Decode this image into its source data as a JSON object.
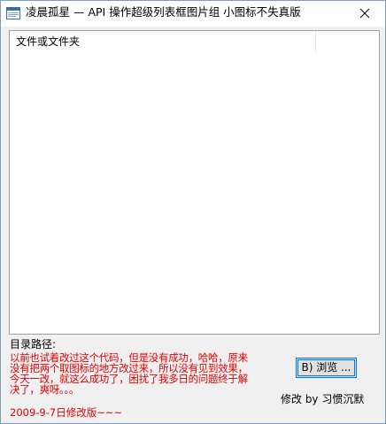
{
  "window": {
    "title": "凌晨孤星 — API 操作超级列表框图片组  小图标不失真版"
  },
  "listview": {
    "columns": [
      "文件或文件夹"
    ]
  },
  "path_section": {
    "label": "目录路径:"
  },
  "note": {
    "lines": [
      "以前也试着改过这个代码，但是没有成功，哈哈，原来",
      "没有把两个取图标的地方改过来，所以没有见到效果，",
      "今天一改，就这么成功了，困扰了我多日的问题终于解",
      "决了，爽呀。。。"
    ]
  },
  "buttons": {
    "browse_label": "B) 浏览 ..."
  },
  "footer": {
    "author": "修改 by 习惯沉默",
    "date_note": "2009-9-7日修改版~~~"
  },
  "colors": {
    "note_text": "#e00000",
    "focus_border": "#0078d7"
  },
  "icons": {
    "app": "app-window-icon",
    "close": "close-icon"
  }
}
